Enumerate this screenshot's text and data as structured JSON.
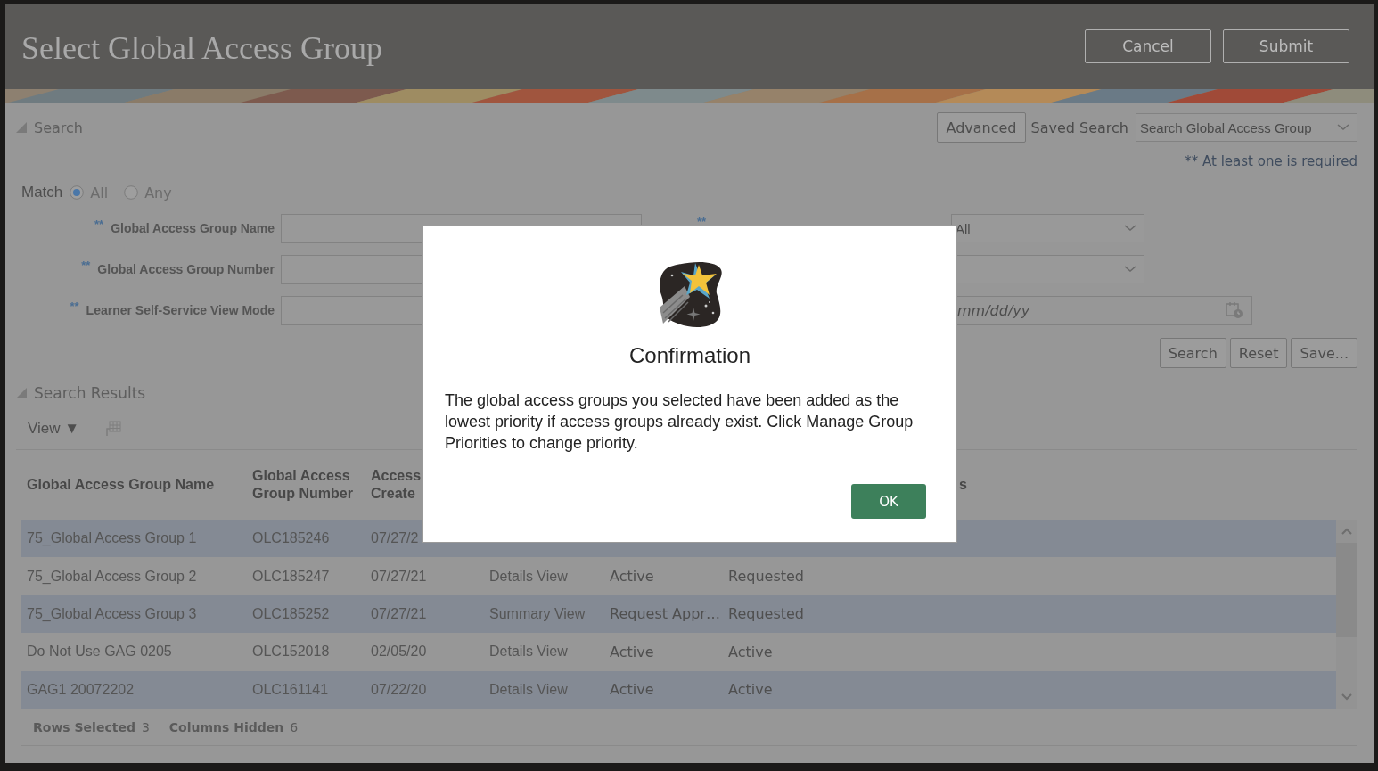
{
  "window": {
    "title": "Select Global Access Group",
    "buttons": [
      {
        "label": "Cancel"
      },
      {
        "label": "Submit"
      }
    ]
  },
  "search": {
    "header": "Search",
    "advanced_button": "Advanced",
    "saved_search_label": "Saved Search",
    "saved_search_value": "Search Global Access Group",
    "required_note": "** At least one is required",
    "match": {
      "label": "Match",
      "options": [
        {
          "label": "All",
          "selected": true
        },
        {
          "label": "Any",
          "selected": false
        }
      ]
    },
    "fields": [
      {
        "mark": "**",
        "label": "Global Access Group Name"
      },
      {
        "mark": "**",
        "label": "Global Access Group Number"
      },
      {
        "mark": "**",
        "label": "Learner Self-Service View Mode"
      }
    ],
    "right_fields": [
      {
        "mark": "**",
        "kind": "select",
        "value": "All"
      },
      {
        "kind": "select"
      },
      {
        "kind": "date",
        "placeholder": "mm/dd/yy"
      }
    ],
    "buttons": [
      {
        "label": "Search"
      },
      {
        "label": "Reset"
      },
      {
        "label": "Save..."
      }
    ]
  },
  "results": {
    "header": "Search Results",
    "view_menu": "View ▼",
    "columns": [
      "Global Access Group Name",
      "Global Access Group Number",
      "Access Create",
      "",
      "",
      "s"
    ],
    "rows": [
      {
        "selected": true,
        "cells": [
          "75_Global Access Group 1",
          "OLC185246",
          "07/27/2"
        ]
      },
      {
        "selected": false,
        "cells": [
          "75_Global Access Group 2",
          "OLC185247",
          "07/27/21",
          "Details View",
          "Active",
          "Requested"
        ]
      },
      {
        "selected": true,
        "cells": [
          "75_Global Access Group 3",
          "OLC185252",
          "07/27/21",
          "Summary View",
          "Request Appr…",
          "Requested"
        ]
      },
      {
        "selected": false,
        "cells": [
          "Do Not Use GAG 0205",
          "OLC152018",
          "02/05/20",
          "Details View",
          "Active",
          "Active"
        ]
      },
      {
        "selected": true,
        "cells": [
          "GAG1 20072202",
          "OLC161141",
          "07/22/20",
          "Details View",
          "Active",
          "Active"
        ]
      }
    ],
    "footer": [
      {
        "label": "Rows Selected",
        "value": "3"
      },
      {
        "label": "Columns Hidden",
        "value": "6"
      }
    ]
  },
  "dialog": {
    "title": "Confirmation",
    "message": "The global access groups you selected have been added as the lowest priority if access groups already exist. Click Manage Group Priorities to change priority.",
    "ok_button": "OK"
  }
}
